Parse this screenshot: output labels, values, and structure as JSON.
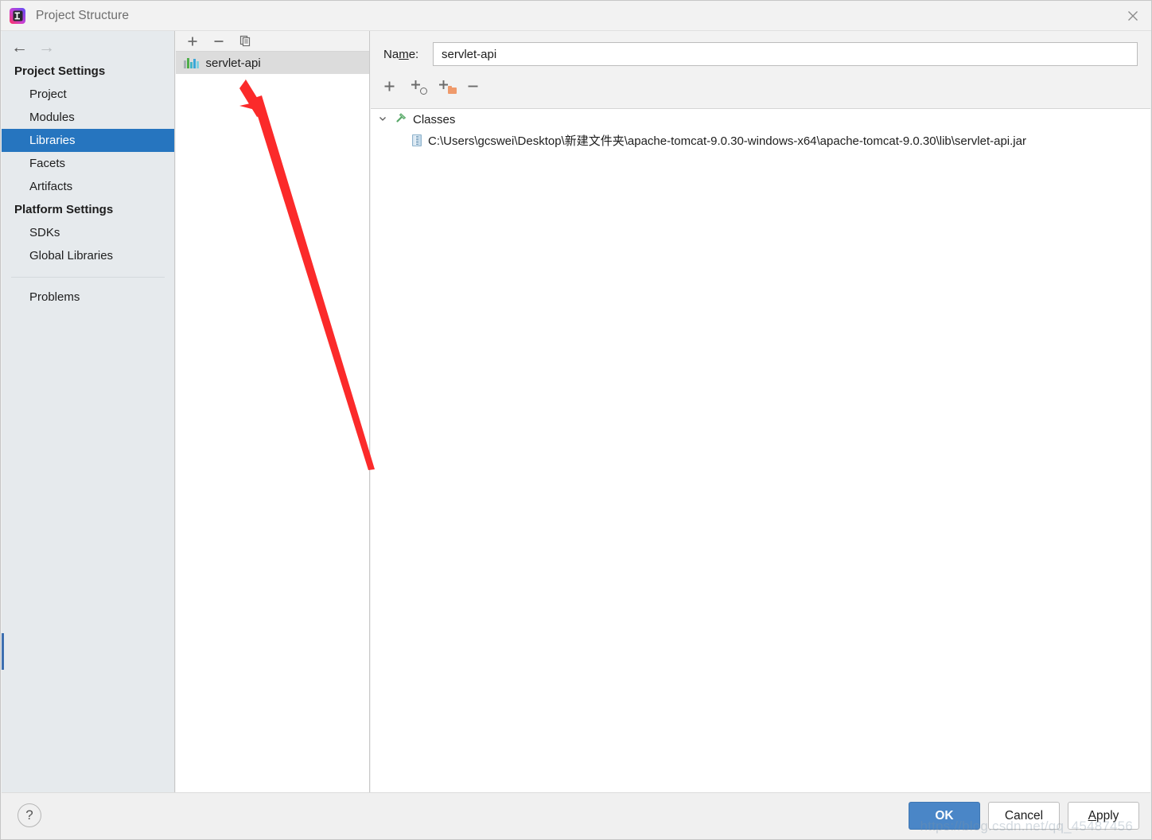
{
  "window": {
    "title": "Project Structure",
    "logo_icon": "intellij-idea-logo",
    "close_icon": "close-icon"
  },
  "sidebar": {
    "back_icon": "arrow-left-icon",
    "forward_icon": "arrow-right-icon",
    "groups": [
      {
        "title": "Project Settings",
        "items": [
          {
            "label": "Project",
            "selected": false
          },
          {
            "label": "Modules",
            "selected": false
          },
          {
            "label": "Libraries",
            "selected": true
          },
          {
            "label": "Facets",
            "selected": false
          },
          {
            "label": "Artifacts",
            "selected": false
          }
        ]
      },
      {
        "title": "Platform Settings",
        "items": [
          {
            "label": "SDKs",
            "selected": false
          },
          {
            "label": "Global Libraries",
            "selected": false
          }
        ]
      }
    ],
    "problems_label": "Problems"
  },
  "list_panel": {
    "toolbar": [
      {
        "name": "add-library-button",
        "glyph": "+"
      },
      {
        "name": "remove-library-button",
        "glyph": "−"
      },
      {
        "name": "copy-library-button",
        "glyph": "copy-icon"
      }
    ],
    "items": [
      {
        "label": "servlet-api",
        "icon": "library-icon",
        "selected": true
      }
    ]
  },
  "detail": {
    "name_label_prefix": "Na",
    "name_label_mnemonic": "m",
    "name_label_suffix": "e:",
    "name_value": "servlet-api",
    "name_placeholder": "",
    "toolbar": [
      {
        "name": "add-attach-files-button",
        "glyph": "+"
      },
      {
        "name": "add-attach-url-button",
        "glyph": "+"
      },
      {
        "name": "add-attach-directory-button",
        "glyph": "+"
      },
      {
        "name": "remove-attachment-button",
        "glyph": "−"
      }
    ],
    "tree": {
      "root": {
        "label": "Classes",
        "icon": "classes-hammer-icon",
        "expanded": true,
        "chevron": "⌄"
      },
      "children": [
        {
          "label": "C:\\Users\\gcswei\\Desktop\\新建文件夹\\apache-tomcat-9.0.30-windows-x64\\apache-tomcat-9.0.30\\lib\\servlet-api.jar",
          "icon": "jar-archive-icon"
        }
      ]
    }
  },
  "footer": {
    "help_label": "?",
    "buttons": [
      {
        "name": "ok-button",
        "label": "OK",
        "primary": true,
        "mnemonic": ""
      },
      {
        "name": "cancel-button",
        "label": "Cancel",
        "primary": false,
        "mnemonic": ""
      },
      {
        "name": "apply-button",
        "label_prefix": "",
        "mnemonic": "A",
        "label_suffix": "pply",
        "primary": false
      }
    ],
    "watermark": "https://blog.csdn.net/qq_45487456"
  },
  "annotation": {
    "arrow_color": "#fb2a2a",
    "description": "red-arrow-pointing-to-library-list-item"
  },
  "colors": {
    "accent": "#2675bf",
    "primary_button": "#4a86c7",
    "sidebar_bg": "#e6eaed",
    "selection_list": "#dcdcdc",
    "annotation_red": "#fb2a2a"
  }
}
